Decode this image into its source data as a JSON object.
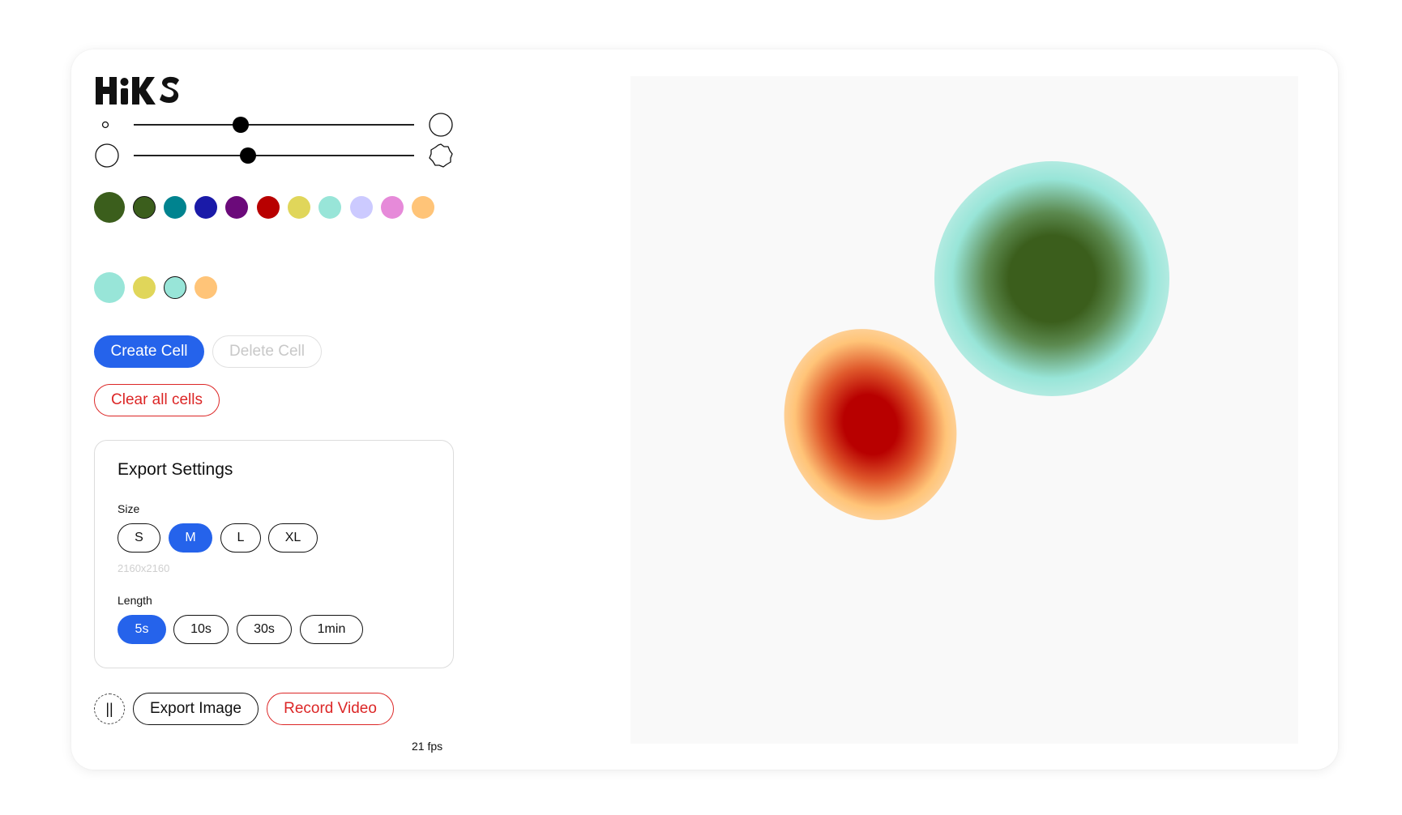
{
  "app": {
    "logo_text": "HiKS",
    "logo_icon": "hiks-logo"
  },
  "controls": {
    "size_slider": {
      "value": 0.38,
      "min_icon": "small-circle-icon",
      "max_icon": "large-circle-icon"
    },
    "shape_slider": {
      "value": 0.41,
      "min_icon": "circle-shape-icon",
      "max_icon": "wobbly-shape-icon"
    }
  },
  "palette": {
    "current_color": "#3b5e1c",
    "colors": [
      "#3b5e1c",
      "#00838f",
      "#1a1aa8",
      "#6b0a7a",
      "#b80000",
      "#e0d65a",
      "#98e5d8",
      "#cccaff",
      "#e68ad9",
      "#ffc478"
    ],
    "selected_index": 0
  },
  "secondary_palette": {
    "current_color": "#98e5d8",
    "colors": [
      "#e0d65a",
      "#98e5d8",
      "#ffc478"
    ],
    "selected_index": 1
  },
  "buttons": {
    "create_cell": "Create Cell",
    "delete_cell": "Delete Cell",
    "clear_all": "Clear all cells",
    "export_image": "Export Image",
    "record_video": "Record Video",
    "pause": "||"
  },
  "export_settings": {
    "title": "Export Settings",
    "size_label": "Size",
    "sizes": [
      "S",
      "M",
      "L",
      "XL"
    ],
    "selected_size": "M",
    "resolution": "2160x2160",
    "length_label": "Length",
    "lengths": [
      "5s",
      "10s",
      "30s",
      "1min"
    ],
    "selected_length": "5s"
  },
  "status": {
    "fps": "21 fps"
  },
  "canvas": {
    "background": "#f9f9f9",
    "cells": [
      {
        "inner_color": "#3b5e1c",
        "outer_color": "#98e5d8"
      },
      {
        "inner_color": "#b80000",
        "outer_color": "#ffc478"
      }
    ]
  }
}
